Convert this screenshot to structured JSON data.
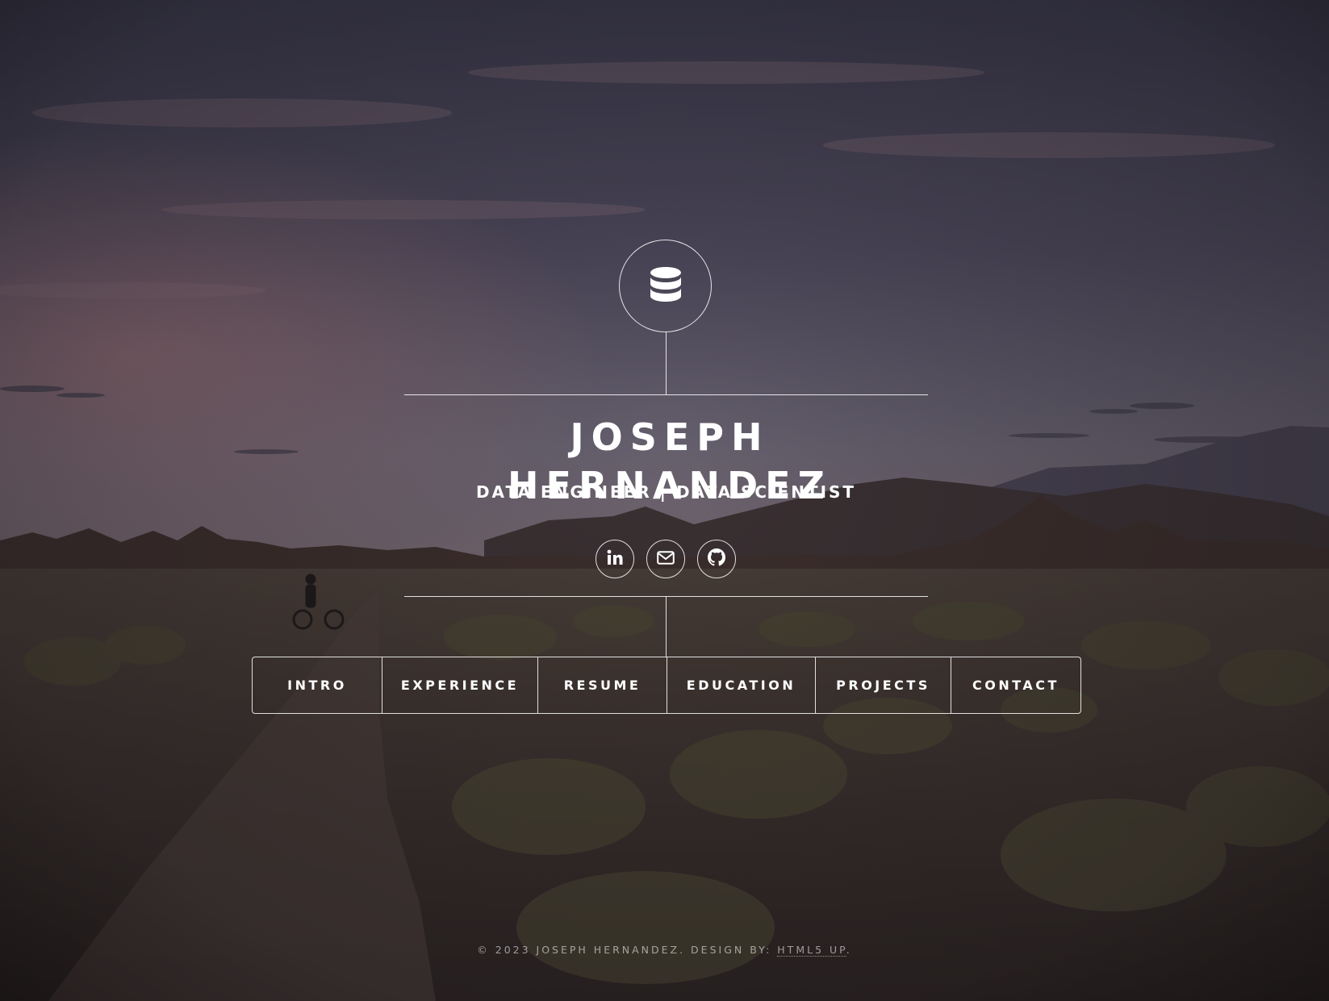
{
  "header": {
    "logo_icon": "database-icon",
    "name": "JOSEPH HERNANDEZ",
    "subtitle": "DATA ENGINEER | DATA SCIENTIST"
  },
  "socials": [
    {
      "icon": "linkedin-icon"
    },
    {
      "icon": "envelope-icon"
    },
    {
      "icon": "github-icon"
    }
  ],
  "nav": {
    "items": [
      {
        "label": "INTRO"
      },
      {
        "label": "EXPERIENCE"
      },
      {
        "label": "RESUME"
      },
      {
        "label": "EDUCATION"
      },
      {
        "label": "PROJECTS"
      },
      {
        "label": "CONTACT"
      }
    ]
  },
  "footer": {
    "copyright": "© 2023 JOSEPH HERNANDEZ. DESIGN BY: ",
    "credit_link": "HTML5 UP",
    "end": "."
  },
  "colors": {
    "text": "#ffffff",
    "sky_top": "#3e3b4e",
    "ground": "#3a2f2b"
  }
}
